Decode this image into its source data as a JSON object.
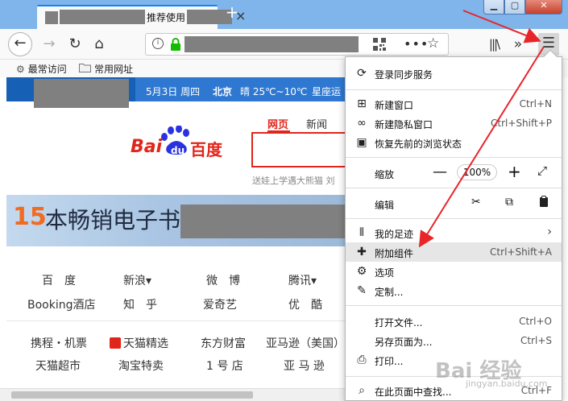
{
  "tab": {
    "title": "推荐使用",
    "close": "×",
    "new_tab": "+"
  },
  "window_controls": {
    "minimize": "▁",
    "maximize": "▢",
    "close": "✕"
  },
  "navbar": {
    "back": "←",
    "forward": "→",
    "reload": "↻",
    "home": "⌂",
    "info": "i",
    "dots": "•••",
    "star": "☆",
    "library": "|||\\",
    "overflow": "»",
    "menu": "☰"
  },
  "bookmarks": [
    {
      "label": "最常访问",
      "icon": "gear-icon"
    },
    {
      "label": "常用网址",
      "icon": "folder-icon"
    }
  ],
  "page": {
    "date": "5月3日 周四",
    "city": "北京",
    "weather": "晴 25℃~10℃",
    "constellation": "星座运",
    "search_tabs": {
      "web": "网页",
      "news": "新闻"
    },
    "logo_text": {
      "bai": "Bai",
      "du": "du",
      "brand": "百度"
    },
    "hint": "送娃上学遇大熊猫  刘",
    "banner": {
      "number": "15",
      "text": "本畅销电子书"
    },
    "sites": [
      [
        "百　度",
        "新浪▾",
        "微　博",
        "腾讯▾"
      ],
      [
        "Booking酒店",
        "知　乎",
        "爱奇艺",
        "优　酷"
      ],
      [
        "携程・机票",
        "天猫精选",
        "东方财富",
        "亚马逊（美国）"
      ],
      [
        "天猫超市",
        "淘宝特卖",
        "1 号 店",
        "亚 马 逊"
      ]
    ]
  },
  "app_menu": {
    "sync": "登录同步服务",
    "new_window": {
      "label": "新建窗口",
      "shortcut": "Ctrl+N"
    },
    "new_private": {
      "label": "新建隐私窗口",
      "shortcut": "Ctrl+Shift+P"
    },
    "restore": "恢复先前的浏览状态",
    "zoom": {
      "label": "缩放",
      "minus": "—",
      "value": "100%",
      "plus": "+",
      "fullscreen": "⤢"
    },
    "edit": {
      "label": "编辑",
      "cut": "✂",
      "copy": "⧉",
      "paste": "📋"
    },
    "library": "我的足迹",
    "addons": {
      "label": "附加组件",
      "shortcut": "Ctrl+Shift+A"
    },
    "options": "选项",
    "customize": "定制...",
    "open_file": {
      "label": "打开文件...",
      "shortcut": "Ctrl+O"
    },
    "save_as": {
      "label": "另存页面为...",
      "shortcut": "Ctrl+S"
    },
    "print": "打印...",
    "find": {
      "label": "在此页面中查找...",
      "shortcut": "Ctrl+F"
    }
  },
  "watermark": {
    "main": "Bai 经验",
    "sub": "jingyan.baidu.com"
  },
  "colors": {
    "accent": "#0a84ff",
    "baidu_red": "#e1251b",
    "baidu_blue": "#2932e1",
    "arrow_red": "#e8262a"
  }
}
